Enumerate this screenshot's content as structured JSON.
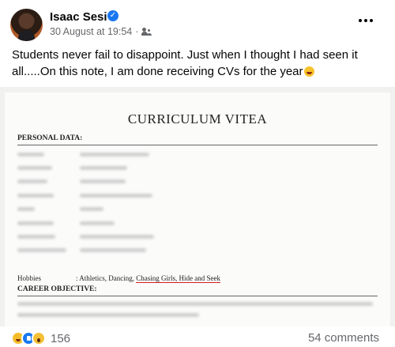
{
  "post": {
    "author": "Isaac Sesi",
    "timestamp": "30 August at 19:54",
    "separator": "·",
    "audience_icon": "friends-icon",
    "caption": "Students never fail to disappoint. Just when I thought I had seen it all.....On this note, I am done receiving CVs for the year",
    "caption_emoji": "laughing-face-emoji"
  },
  "document": {
    "title": "CURRICULUM VITEA",
    "personal_heading": "PERSONAL DATA:",
    "hobbies_label": "Hobbies",
    "hobbies_prefix": ": Athletics, Dancing, ",
    "hobbies_highlight": "Chasing Girls, Hide and Seek",
    "career_heading": "CAREER OBJECTIVE:"
  },
  "footer": {
    "reaction_icons": [
      "haha-reaction-icon",
      "like-reaction-icon",
      "wow-reaction-icon"
    ],
    "reaction_count": "156",
    "comments": "54 comments"
  },
  "colors": {
    "verified": "#1877f2",
    "highlight_underline": "#d21f1f",
    "meta_text": "#65676b"
  }
}
